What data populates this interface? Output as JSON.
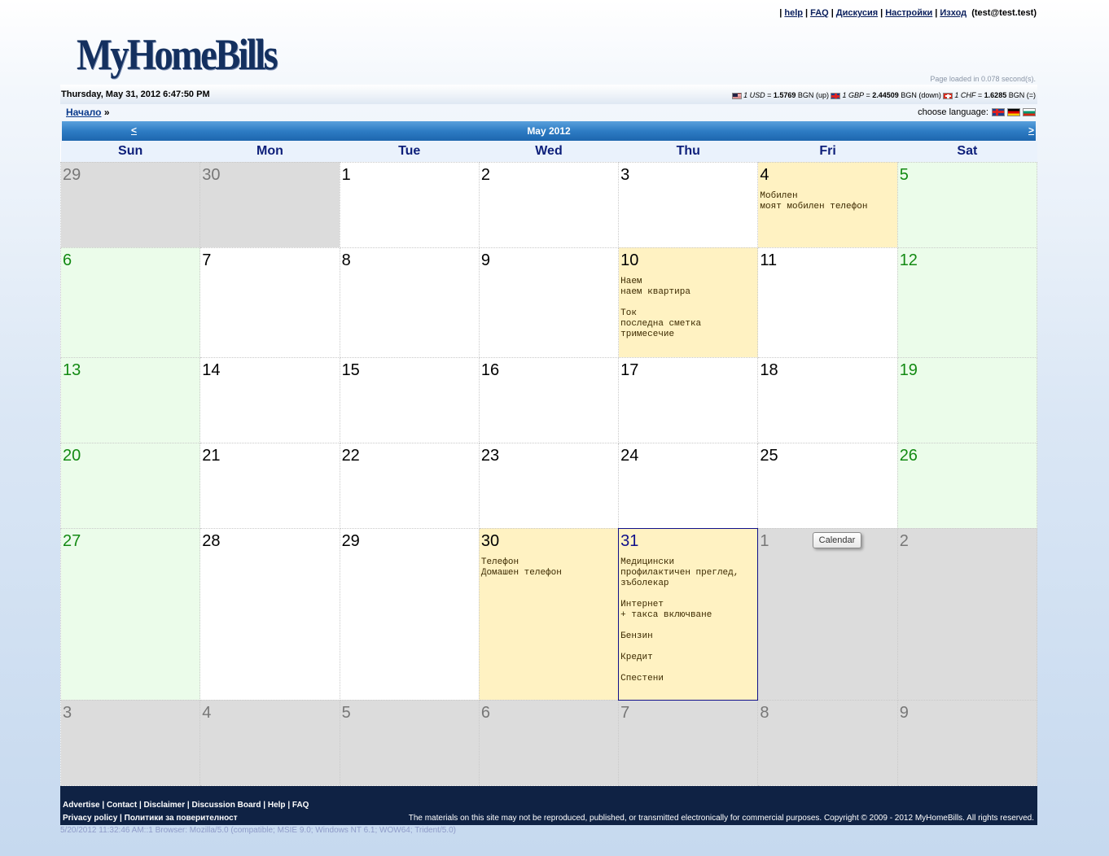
{
  "header": {
    "logo": "MyHomeBills",
    "links": [
      "help",
      "FAQ",
      "Дискусия",
      "Настройки",
      "Изход"
    ],
    "user": "(test@test.test)",
    "page_loaded": "Page loaded in 0.078 second(s)."
  },
  "datebar": {
    "date": "Thursday, May 31, 2012 6:47:50 PM",
    "rates": [
      {
        "flag": "us-flag",
        "amount": "1 USD",
        "value": "1.5769",
        "currency": "BGN",
        "trend": "(up)"
      },
      {
        "flag": "gb-flag",
        "amount": "1 GBP",
        "value": "2.44509",
        "currency": "BGN",
        "trend": "(down)"
      },
      {
        "flag": "ch-flag",
        "amount": "1 CHF",
        "value": "1.6285",
        "currency": "BGN",
        "trend": "(=)"
      }
    ]
  },
  "breadcrumb": {
    "home": "Начало",
    "sep": "»"
  },
  "language": {
    "label": "choose language:",
    "options": [
      "English",
      "Deutsch",
      "Български"
    ]
  },
  "calendar": {
    "month": "May 2012",
    "prev": "<",
    "next": ">",
    "days": [
      "Sun",
      "Mon",
      "Tue",
      "Wed",
      "Thu",
      "Fri",
      "Sat"
    ],
    "weeks": [
      [
        {
          "n": "29",
          "type": "other"
        },
        {
          "n": "30",
          "type": "other"
        },
        {
          "n": "1"
        },
        {
          "n": "2"
        },
        {
          "n": "3"
        },
        {
          "n": "4",
          "type": "bill",
          "events": [
            {
              "title": "Мобилен",
              "desc": "моят мобилен телефон"
            }
          ]
        },
        {
          "n": "5",
          "type": "weekend"
        }
      ],
      [
        {
          "n": "6",
          "type": "weekend"
        },
        {
          "n": "7"
        },
        {
          "n": "8"
        },
        {
          "n": "9"
        },
        {
          "n": "10",
          "type": "bill",
          "events": [
            {
              "title": "Наем",
              "desc": "наем квартира"
            },
            {
              "title": "Ток",
              "desc": "последна сметка тримесечие"
            }
          ]
        },
        {
          "n": "11"
        },
        {
          "n": "12",
          "type": "weekend"
        }
      ],
      [
        {
          "n": "13",
          "type": "weekend"
        },
        {
          "n": "14"
        },
        {
          "n": "15"
        },
        {
          "n": "16"
        },
        {
          "n": "17"
        },
        {
          "n": "18"
        },
        {
          "n": "19",
          "type": "weekend"
        }
      ],
      [
        {
          "n": "20",
          "type": "weekend"
        },
        {
          "n": "21"
        },
        {
          "n": "22"
        },
        {
          "n": "23"
        },
        {
          "n": "24"
        },
        {
          "n": "25"
        },
        {
          "n": "26",
          "type": "weekend"
        }
      ],
      [
        {
          "n": "27",
          "type": "weekend"
        },
        {
          "n": "28"
        },
        {
          "n": "29"
        },
        {
          "n": "30",
          "type": "bill",
          "events": [
            {
              "title": "Телефон",
              "desc": "Домашен телефон"
            }
          ]
        },
        {
          "n": "31",
          "type": "today",
          "events": [
            {
              "title": "Медицински",
              "desc": "профилактичен преглед, зъболекар"
            },
            {
              "title": "Интернет",
              "desc": "+ такса включване"
            },
            {
              "title": "Бензин",
              "desc": ""
            },
            {
              "title": "Кредит",
              "desc": ""
            },
            {
              "title": "Спестени",
              "desc": ""
            }
          ]
        },
        {
          "n": "1",
          "type": "other"
        },
        {
          "n": "2",
          "type": "other"
        }
      ],
      [
        {
          "n": "3",
          "type": "other"
        },
        {
          "n": "4",
          "type": "other"
        },
        {
          "n": "5",
          "type": "other"
        },
        {
          "n": "6",
          "type": "other"
        },
        {
          "n": "7",
          "type": "other"
        },
        {
          "n": "8",
          "type": "other"
        },
        {
          "n": "9",
          "type": "other"
        }
      ]
    ],
    "tooltip": "Calendar"
  },
  "footer": {
    "links1": [
      "Advertise",
      "Contact",
      "Disclaimer",
      "Discussion Board",
      "Help",
      "FAQ"
    ],
    "links2": [
      "Privacy policy",
      "Политики за поверителност"
    ],
    "copyright": "The materials on this site may not be reproduced, published, or transmitted electronically for commercial purposes. Copyright © 2009 - 2012 MyHomeBills. All rights reserved.",
    "browser": "5/20/2012 11:32:46 AM::1 Browser: Mozilla/5.0 (compatible; MSIE 9.0; Windows NT 6.1; WOW64; Trident/5.0)"
  }
}
